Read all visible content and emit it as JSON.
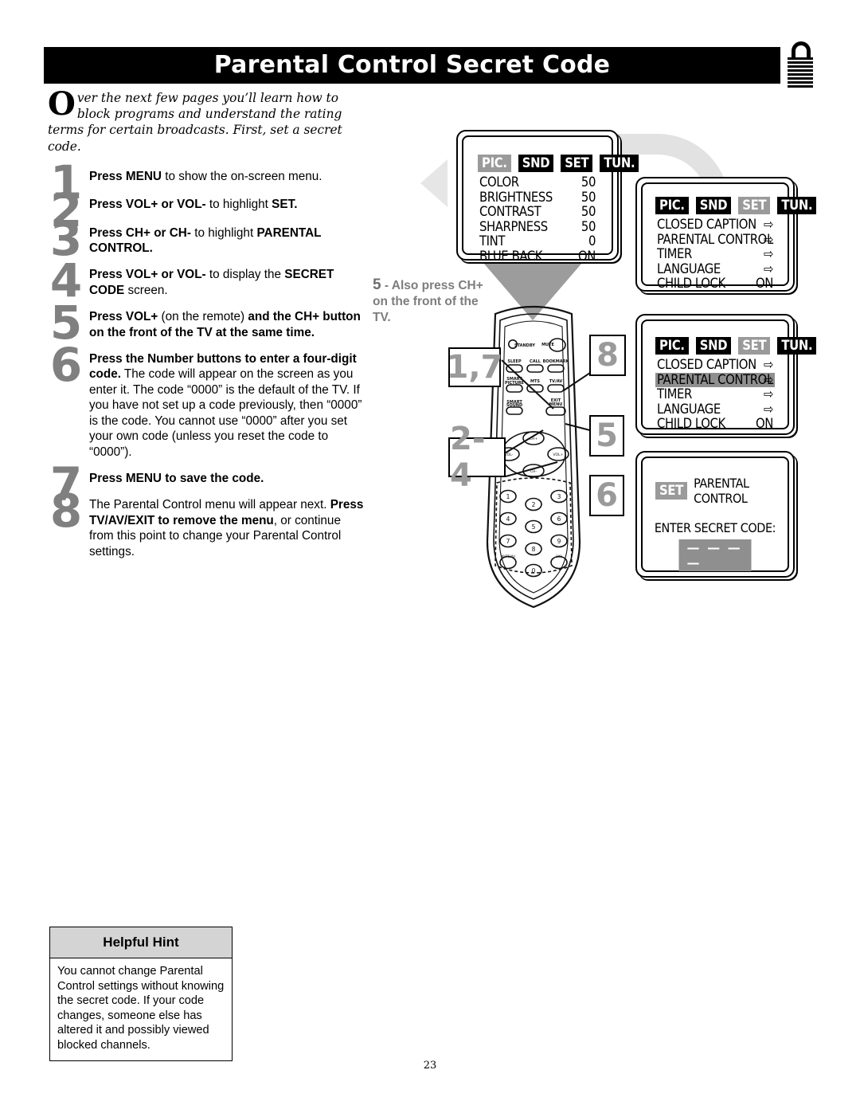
{
  "header": {
    "title": "Parental Control Secret Code",
    "lock_icon": "open-padlock-icon"
  },
  "intro": {
    "dropcap": "O",
    "text": "ver the next few pages you’ll learn how to block programs and understand the rating terms for certain broadcasts. First, set a secret code."
  },
  "steps": [
    {
      "num": "1",
      "html": "<b>Press MENU</b> to show the on-screen menu."
    },
    {
      "num": "2",
      "html": "<b>Press VOL+ or VOL-</b> to highlight <b>SET.</b>"
    },
    {
      "num": "3",
      "html": "<b>Press CH+ or CH-</b> to highlight <b>PARENTAL CONTROL.</b>"
    },
    {
      "num": "4",
      "html": "<b>Press VOL+ or VOL-</b> to display the <b>SECRET CODE</b> screen."
    },
    {
      "num": "5",
      "html": "<b>Press VOL+</b> (on the remote) <b>and the CH+ button on the front of the TV at the same time.</b>"
    },
    {
      "num": "6",
      "html": "<b>Press the Number buttons to enter a four-digit code.</b> The code will appear on the screen as you enter it. The code “0000” is the default of the TV. If you have not set up a code previously, then “0000” is the code. You cannot use “0000” after you set your own code (unless you reset the code to “0000”)."
    },
    {
      "num": "7",
      "html": "<b>Press MENU to save the code.</b>"
    },
    {
      "num": "8",
      "html": "The Parental Control menu will appear next. <b>Press TV/AV/EXIT to remove the menu</b>, or continue from this point to change your Parental Control settings."
    }
  ],
  "hint": {
    "title": "Helpful Hint",
    "body": "You cannot change Parental Control settings without knowing the secret code. If your code changes, someone else has altered it and possibly viewed blocked channels."
  },
  "page_number": "23",
  "also_press": {
    "step": "5",
    "text": " - Also press CH+ on the front of the TV."
  },
  "callouts": [
    {
      "id": "callout-1-7",
      "label": "1,7"
    },
    {
      "id": "callout-8",
      "label": "8"
    },
    {
      "id": "callout-2-4",
      "label": "2-4"
    },
    {
      "id": "callout-5",
      "label": "5"
    },
    {
      "id": "callout-6",
      "label": "6"
    }
  ],
  "tv_screens": [
    {
      "id": "picture-menu",
      "tabs": [
        {
          "label": "PIC.",
          "selected": true
        },
        {
          "label": "SND",
          "selected": false
        },
        {
          "label": "SET",
          "selected": false
        },
        {
          "label": "TUN.",
          "selected": false
        }
      ],
      "rows": [
        {
          "label": "COLOR",
          "value": "50",
          "highlighted": false
        },
        {
          "label": "BRIGHTNESS",
          "value": "50",
          "highlighted": false
        },
        {
          "label": "CONTRAST",
          "value": "50",
          "highlighted": false
        },
        {
          "label": "SHARPNESS",
          "value": "50",
          "highlighted": false
        },
        {
          "label": "TINT",
          "value": "0",
          "highlighted": false
        },
        {
          "label": "BLUE BACK",
          "value": "ON",
          "highlighted": false
        }
      ]
    },
    {
      "id": "set-menu",
      "tabs": [
        {
          "label": "PIC.",
          "selected": false
        },
        {
          "label": "SND",
          "selected": false
        },
        {
          "label": "SET",
          "selected": true
        },
        {
          "label": "TUN.",
          "selected": false
        }
      ],
      "rows": [
        {
          "label": "CLOSED CAPTION",
          "value": "⇨",
          "highlighted": false
        },
        {
          "label": "PARENTAL CONTROL",
          "value": "⇨",
          "highlighted": false
        },
        {
          "label": "TIMER",
          "value": "⇨",
          "highlighted": false
        },
        {
          "label": "LANGUAGE",
          "value": "⇨",
          "highlighted": false
        },
        {
          "label": "CHILD LOCK",
          "value": "ON",
          "highlighted": false
        }
      ]
    },
    {
      "id": "set-menu-parental-highlighted",
      "tabs": [
        {
          "label": "PIC.",
          "selected": false
        },
        {
          "label": "SND",
          "selected": false
        },
        {
          "label": "SET",
          "selected": true
        },
        {
          "label": "TUN.",
          "selected": false
        }
      ],
      "rows": [
        {
          "label": "CLOSED CAPTION",
          "value": "⇨",
          "highlighted": false
        },
        {
          "label": "PARENTAL CONTROL",
          "value": "⇨",
          "highlighted": true
        },
        {
          "label": "TIMER",
          "value": "⇨",
          "highlighted": false
        },
        {
          "label": "LANGUAGE",
          "value": "⇨",
          "highlighted": false
        },
        {
          "label": "CHILD LOCK",
          "value": "ON",
          "highlighted": false
        }
      ]
    }
  ],
  "secret_code_screen": {
    "id": "secret-code-screen",
    "tag": "SET",
    "heading": "PARENTAL CONTROL",
    "prompt": "ENTER SECRET CODE:",
    "code_placeholder": "— — — —"
  },
  "remote": {
    "buttons": [
      "STANDBY",
      "MUTE",
      "SLEEP",
      "CALL",
      "BOOKMARK",
      "SMART PICTURE",
      "MTS",
      "TV/AV",
      "SMART SOUND",
      "EXIT MENU",
      "CH+",
      "CH-",
      "VOL-",
      "VOL+",
      "1",
      "2",
      "3",
      "4",
      "5",
      "6",
      "7",
      "8",
      "9",
      "0"
    ]
  },
  "colors": {
    "header_bar": "#000000",
    "step_number": "#808080",
    "menu_highlight": "#8f8f8f",
    "tab_selected": "#9a9a9a",
    "hint_header": "#d4d4d4",
    "arrow_gray": "#9c9c9c"
  }
}
